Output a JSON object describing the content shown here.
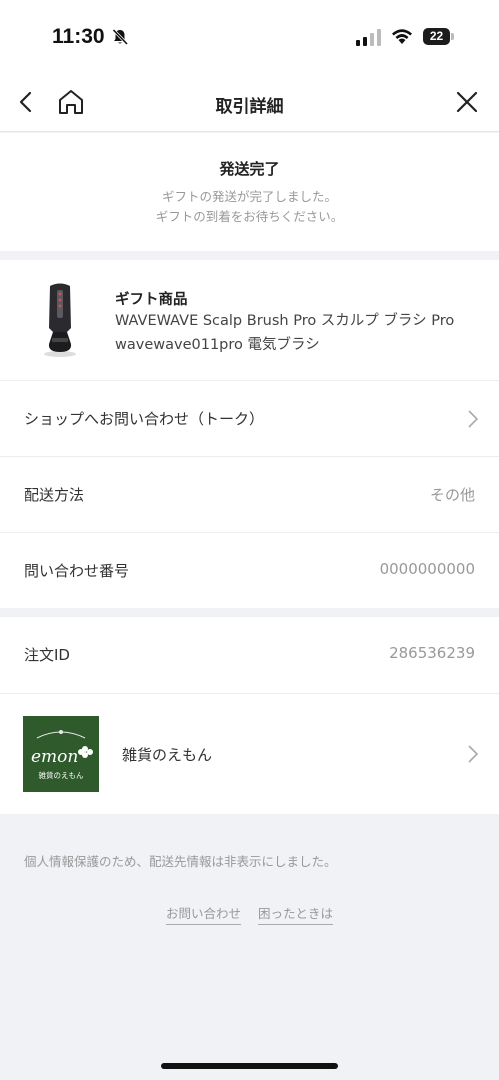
{
  "status_bar": {
    "time": "11:30",
    "battery": "22",
    "icons": [
      "bell-slash-icon",
      "signal-icon",
      "wifi-icon",
      "battery-icon"
    ]
  },
  "nav": {
    "title": "取引詳細",
    "icons": [
      "back-icon",
      "home-icon",
      "close-icon"
    ]
  },
  "status": {
    "title": "発送完了",
    "line1": "ギフトの発送が完了しました。",
    "line2": "ギフトの到着をお待ちください。"
  },
  "product": {
    "label": "ギフト商品",
    "name": "WAVEWAVE Scalp Brush Pro スカルプ ブラシ Pro wavewave011pro 電気ブラシ"
  },
  "rows": {
    "contact_shop": {
      "label": "ショップへお問い合わせ（トーク）"
    },
    "shipping_method": {
      "label": "配送方法",
      "value": "その他"
    },
    "inquiry_number": {
      "label": "問い合わせ番号",
      "value": "0000000000"
    },
    "order_id": {
      "label": "注文ID",
      "value": "286536239"
    }
  },
  "shop": {
    "name": "雑貨のえもん",
    "logo_text": "emon",
    "logo_subtext": "雑貨のえもん"
  },
  "footer": {
    "note": "個人情報保護のため、配送先情報は非表示にしました。",
    "link_contact": "お問い合わせ",
    "link_help": "困ったときは"
  },
  "colors": {
    "background": "#f1f2f6",
    "card": "#ffffff",
    "muted_text": "#999999",
    "shop_logo_bg": "#2e5a2c"
  }
}
